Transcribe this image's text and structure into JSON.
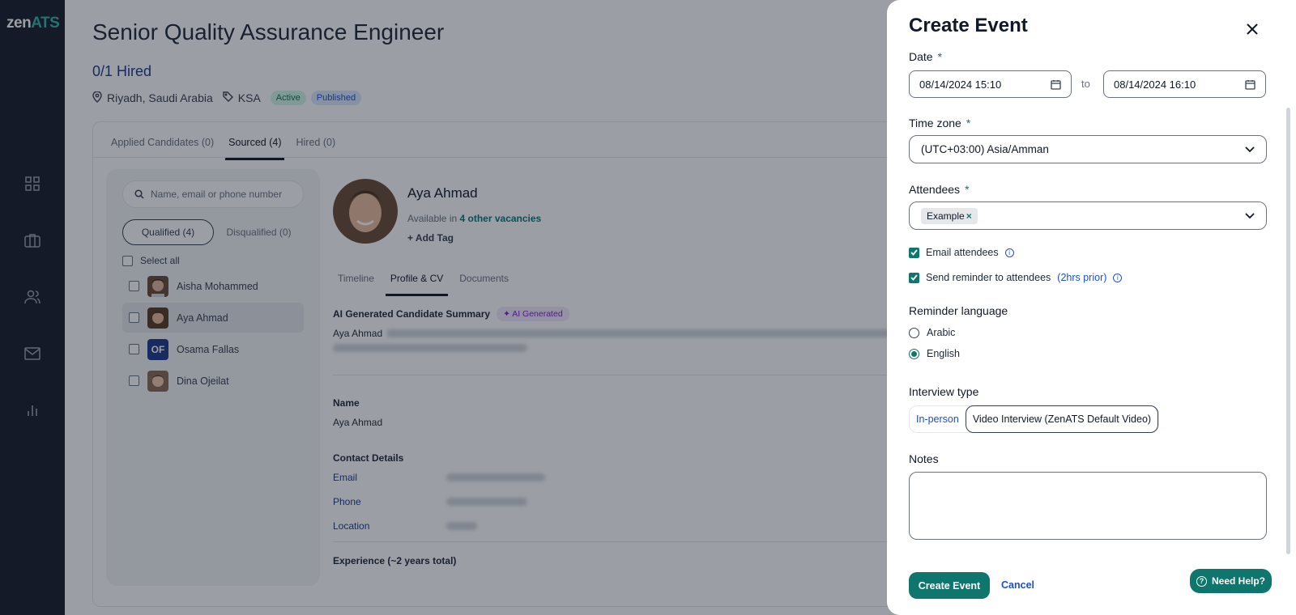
{
  "brand": {
    "logo_zen": "zen",
    "logo_ats": "ATS"
  },
  "sidebar": {
    "items": [
      {
        "icon": "dashboard-icon"
      },
      {
        "icon": "briefcase-icon"
      },
      {
        "icon": "users-icon"
      },
      {
        "icon": "mail-icon"
      },
      {
        "icon": "analytics-icon"
      }
    ]
  },
  "job": {
    "title": "Senior Quality Assurance Engineer",
    "hired": "0/1 Hired",
    "location": "Riyadh, Saudi Arabia",
    "tag": "KSA",
    "status_badge": "Active",
    "publish_badge": "Published"
  },
  "tabs": [
    "Applied Candidates (0)",
    "Sourced (4)",
    "Hired (0)"
  ],
  "candidates_panel": {
    "search_placeholder": "Name, email or phone number",
    "qualified": "Qualified (4)",
    "disqualified": "Disqualified (0)",
    "select_all": "Select all",
    "list": [
      {
        "name": "Aisha Mohammed",
        "initials": ""
      },
      {
        "name": "Aya Ahmad",
        "initials": ""
      },
      {
        "name": "Osama Fallas",
        "initials": "OF"
      },
      {
        "name": "Dina Ojeilat",
        "initials": ""
      }
    ]
  },
  "profile": {
    "name": "Aya Ahmad",
    "available_prefix": "Available in",
    "available_link": "4 other vacancies",
    "add_tag": "+ Add Tag",
    "tabs": [
      "Timeline",
      "Profile & CV",
      "Documents"
    ],
    "ai_summary_title": "AI Generated Candidate Summary",
    "ai_badge": "✦ AI Generated",
    "summary_start": "Aya Ahmad",
    "name_label": "Name",
    "name_value": "Aya Ahmad",
    "contact_title": "Contact Details",
    "email_label": "Email",
    "phone_label": "Phone",
    "location_label": "Location",
    "experience_title": "Experience (~2 years total)"
  },
  "drawer": {
    "title": "Create Event",
    "date_label": "Date",
    "required_mark": "*",
    "date_from": "08/14/2024 15:10",
    "to_label": "to",
    "date_to": "08/14/2024 16:10",
    "timezone_label": "Time zone",
    "timezone_value": "(UTC+03:00) Asia/Amman",
    "attendees_label": "Attendees",
    "attendee_chip": "Example",
    "email_attendees": "Email attendees",
    "send_reminder": "Send reminder to attendees",
    "reminder_hint": "(2hrs prior)",
    "reminder_language_label": "Reminder language",
    "lang_arabic": "Arabic",
    "lang_english": "English",
    "interview_type_label": "Interview type",
    "type_inperson": "In-person",
    "type_video": "Video Interview (ZenATS Default Video)",
    "notes_label": "Notes",
    "create_button": "Create Event",
    "cancel_button": "Cancel",
    "help_button": "Need Help?"
  },
  "colors": {
    "accent": "#0f766e",
    "sidebar_bg": "#171c28",
    "link": "#1d4ed8"
  }
}
